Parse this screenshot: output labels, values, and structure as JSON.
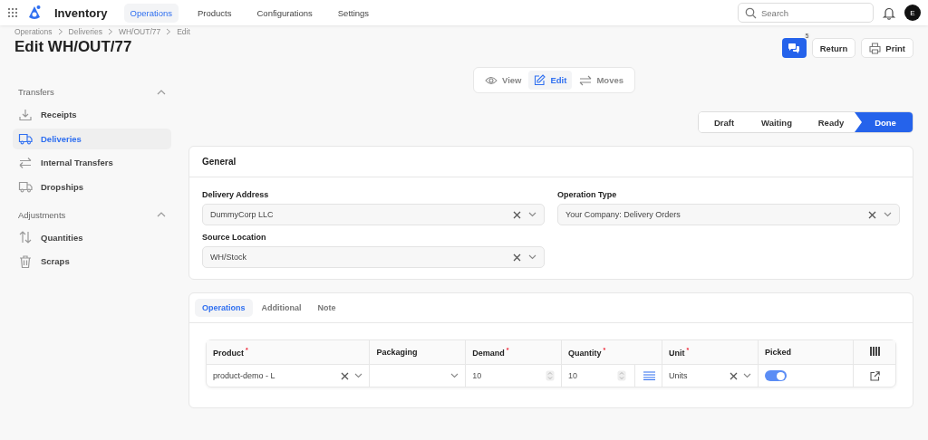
{
  "app": {
    "title": "Inventory"
  },
  "nav": [
    {
      "label": "Operations",
      "selected": true
    },
    {
      "label": "Products",
      "selected": false
    },
    {
      "label": "Configurations",
      "selected": false
    },
    {
      "label": "Settings",
      "selected": false
    }
  ],
  "search": {
    "placeholder": "Search"
  },
  "user": {
    "initial": "E"
  },
  "breadcrumbs": [
    "Operations",
    "Deliveries",
    "WH/OUT/77",
    "Edit"
  ],
  "page_title": "Edit WH/OUT/77",
  "actions": {
    "comments_count": "5",
    "return": "Return",
    "print": "Print"
  },
  "sidebar": [
    {
      "title": "Transfers",
      "expanded": true,
      "items": [
        {
          "label": "Receipts",
          "selected": false
        },
        {
          "label": "Deliveries",
          "selected": true
        },
        {
          "label": "Internal Transfers",
          "selected": false
        },
        {
          "label": "Dropships",
          "selected": false
        }
      ]
    },
    {
      "title": "Adjustments",
      "expanded": true,
      "items": [
        {
          "label": "Quantities",
          "selected": false
        },
        {
          "label": "Scraps",
          "selected": false
        }
      ]
    }
  ],
  "view_modes": [
    {
      "label": "View",
      "selected": false
    },
    {
      "label": "Edit",
      "selected": true
    },
    {
      "label": "Moves",
      "selected": false
    }
  ],
  "statuses": [
    {
      "label": "Draft",
      "selected": false
    },
    {
      "label": "Waiting",
      "selected": false
    },
    {
      "label": "Ready",
      "selected": false
    },
    {
      "label": "Done",
      "selected": true
    }
  ],
  "general": {
    "title": "General",
    "fields": [
      {
        "label": "Delivery Address",
        "value": "DummyCorp LLC"
      },
      {
        "label": "Operation Type",
        "value": "Your Company: Delivery Orders"
      },
      {
        "label": "Source Location",
        "value": "WH/Stock"
      }
    ]
  },
  "tabs": [
    {
      "label": "Operations",
      "selected": true
    },
    {
      "label": "Additional",
      "selected": false
    },
    {
      "label": "Note",
      "selected": false
    }
  ],
  "table": {
    "columns": [
      {
        "label": "Product",
        "marker": "*"
      },
      {
        "label": "Packaging"
      },
      {
        "label": "Demand",
        "marker": "*"
      },
      {
        "label": "Quantity",
        "marker": "*"
      },
      {
        "label": "Unit",
        "marker": "*"
      },
      {
        "label": "Picked"
      }
    ],
    "rows": [
      {
        "product": "product-demo - L",
        "demand": "10",
        "quantity": "10",
        "unit": "Units",
        "picked": true
      }
    ]
  }
}
